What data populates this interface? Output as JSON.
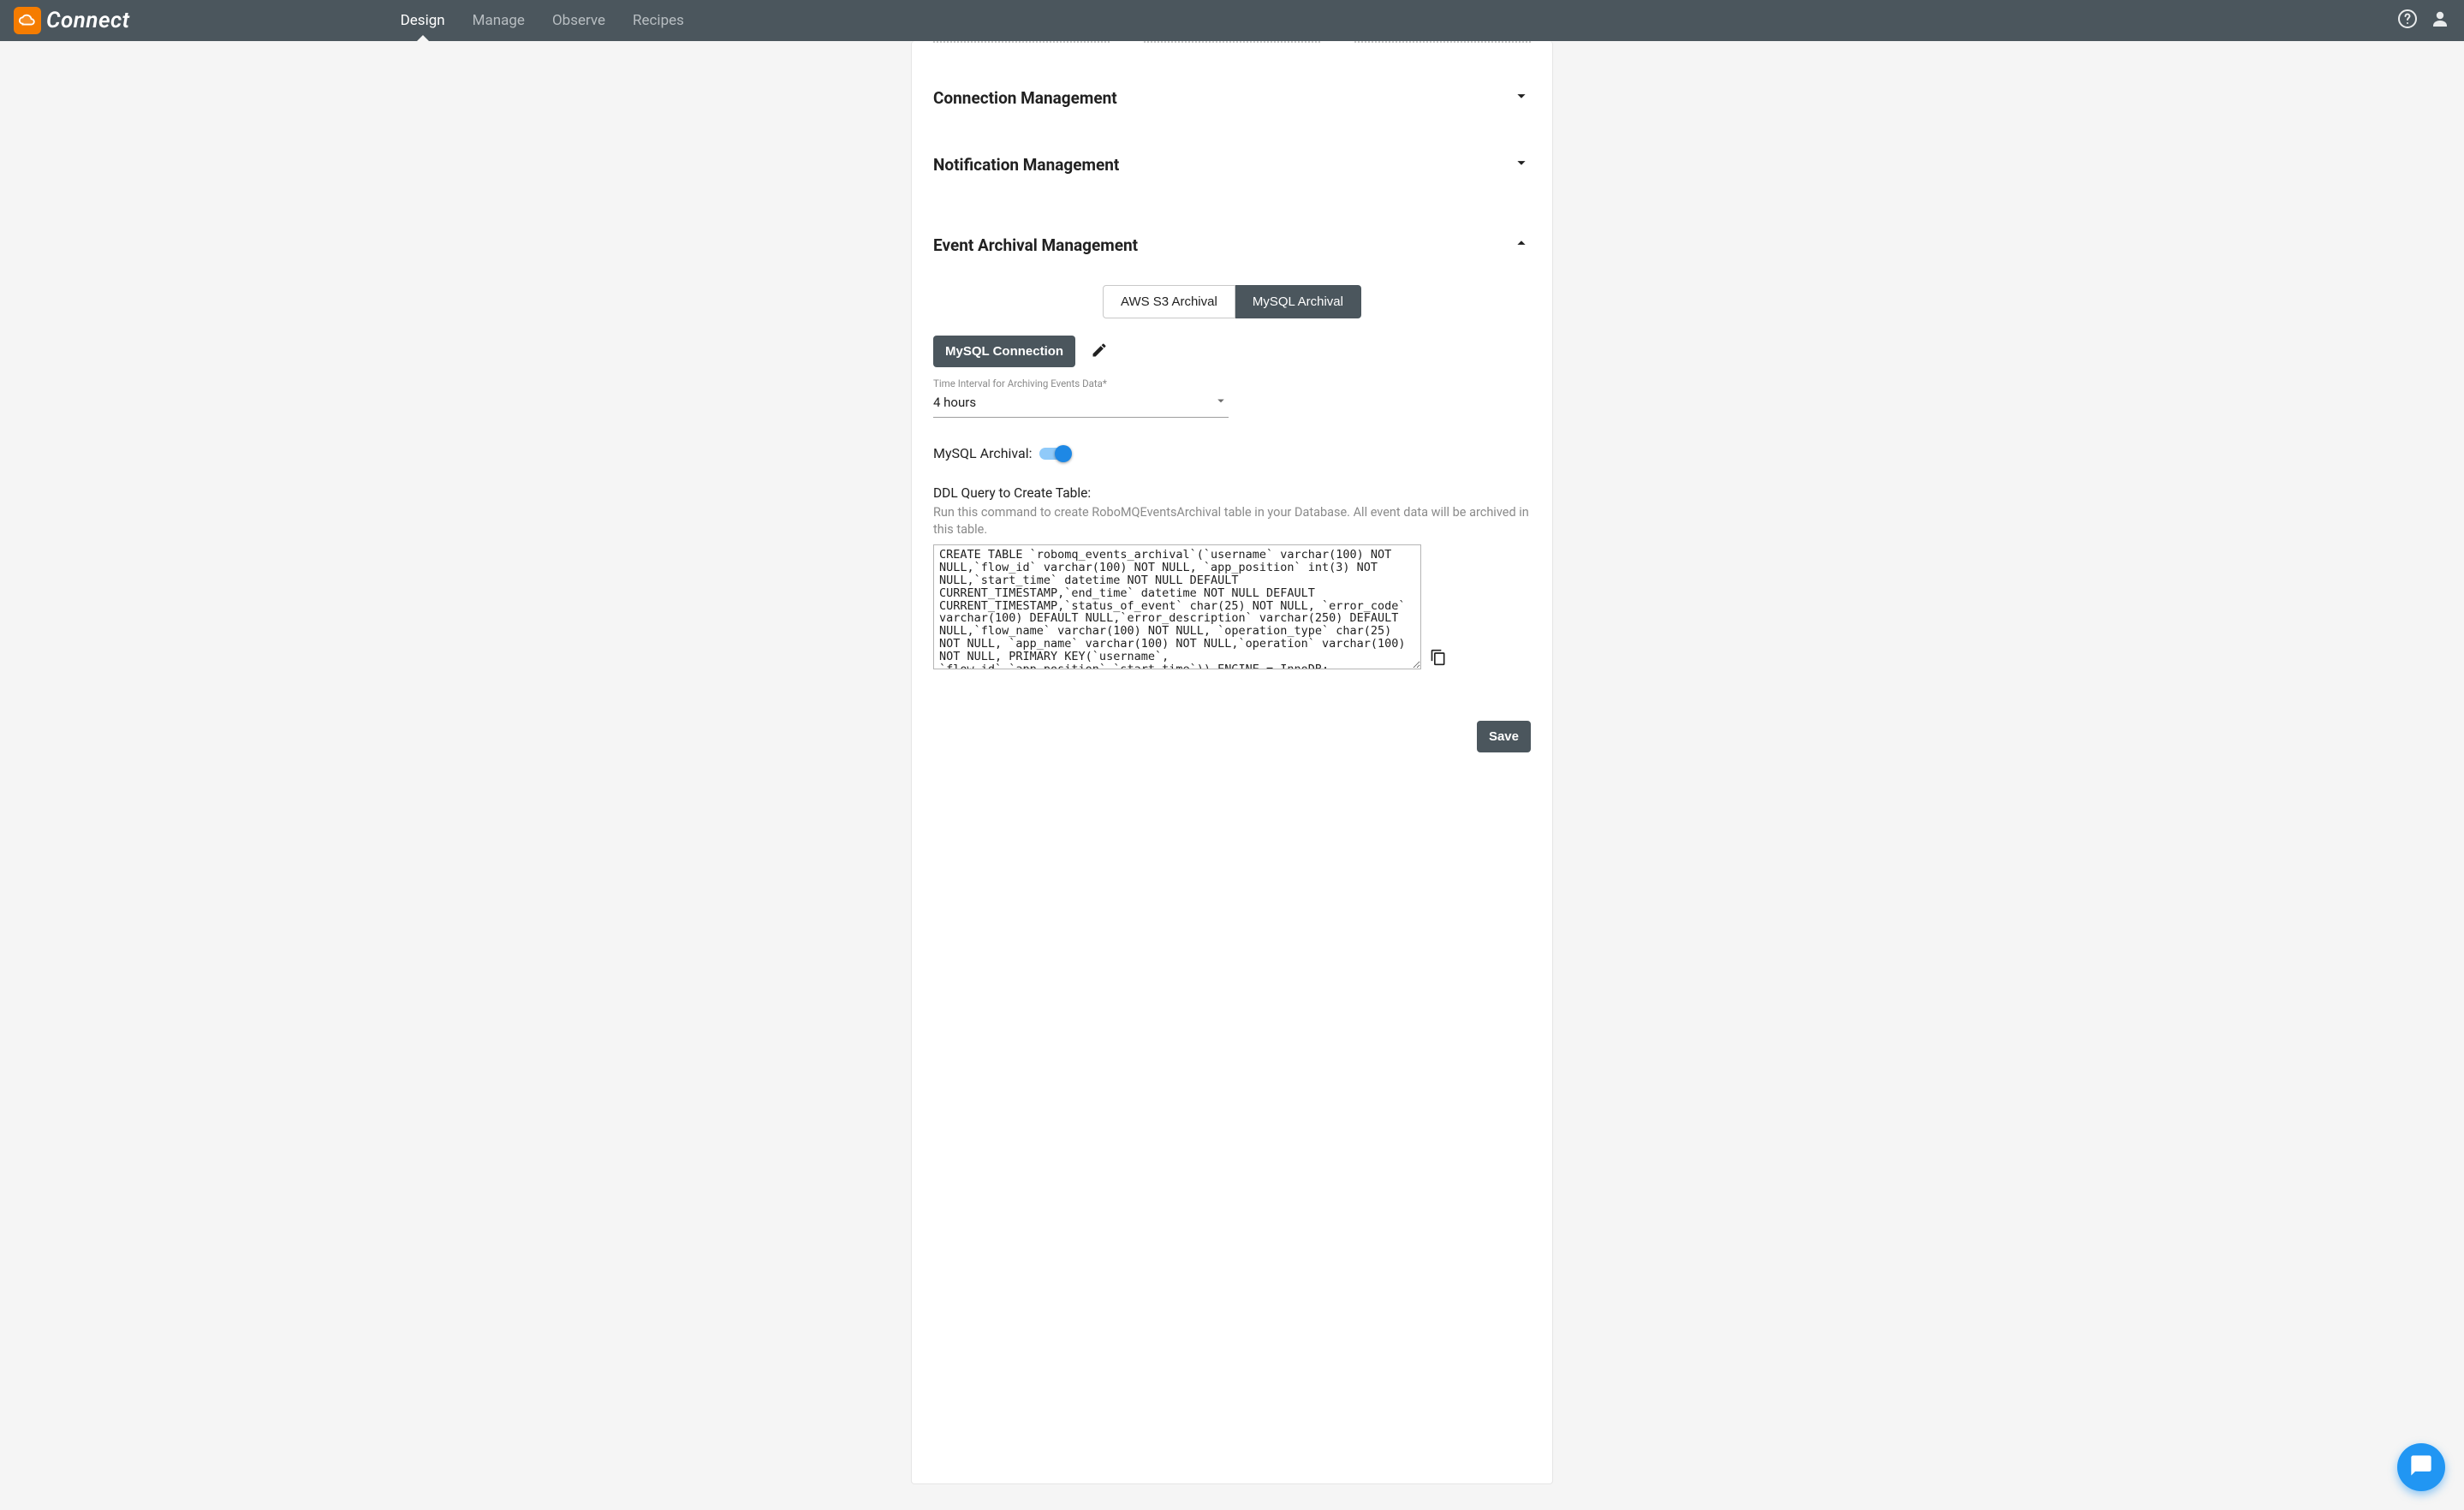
{
  "brand": {
    "name": "Connect"
  },
  "nav": {
    "tabs": [
      {
        "label": "Design",
        "active": true
      },
      {
        "label": "Manage",
        "active": false
      },
      {
        "label": "Observe",
        "active": false
      },
      {
        "label": "Recipes",
        "active": false
      }
    ]
  },
  "sections": {
    "connection": {
      "title": "Connection Management",
      "expanded": false
    },
    "notification": {
      "title": "Notification Management",
      "expanded": false
    },
    "archival": {
      "title": "Event Archival Management",
      "expanded": true
    }
  },
  "archival": {
    "tabs": [
      {
        "label": "AWS S3 Archival",
        "active": false
      },
      {
        "label": "MySQL Archival",
        "active": true
      }
    ],
    "mysql_connection_button": "MySQL Connection",
    "interval_label": "Time Interval for Archiving Events Data*",
    "interval_value": "4 hours",
    "toggle_label": "MySQL Archival:",
    "toggle_on": true,
    "ddl_title": "DDL Query to Create Table:",
    "ddl_help": "Run this command to create RoboMQEventsArchival table in your Database. All event data will be archived in this table.",
    "ddl_query": "CREATE TABLE `robomq_events_archival`(`username` varchar(100) NOT NULL,`flow_id` varchar(100) NOT NULL, `app_position` int(3) NOT NULL,`start_time` datetime NOT NULL DEFAULT CURRENT_TIMESTAMP,`end_time` datetime NOT NULL DEFAULT CURRENT_TIMESTAMP,`status_of_event` char(25) NOT NULL, `error_code` varchar(100) DEFAULT NULL,`error_description` varchar(250) DEFAULT NULL,`flow_name` varchar(100) NOT NULL, `operation_type` char(25) NOT NULL, `app_name` varchar(100) NOT NULL,`operation` varchar(100) NOT NULL, PRIMARY KEY(`username`, `flow_id`,`app_position`,`start_time`)) ENGINE = InnoDB;",
    "save_button": "Save"
  }
}
